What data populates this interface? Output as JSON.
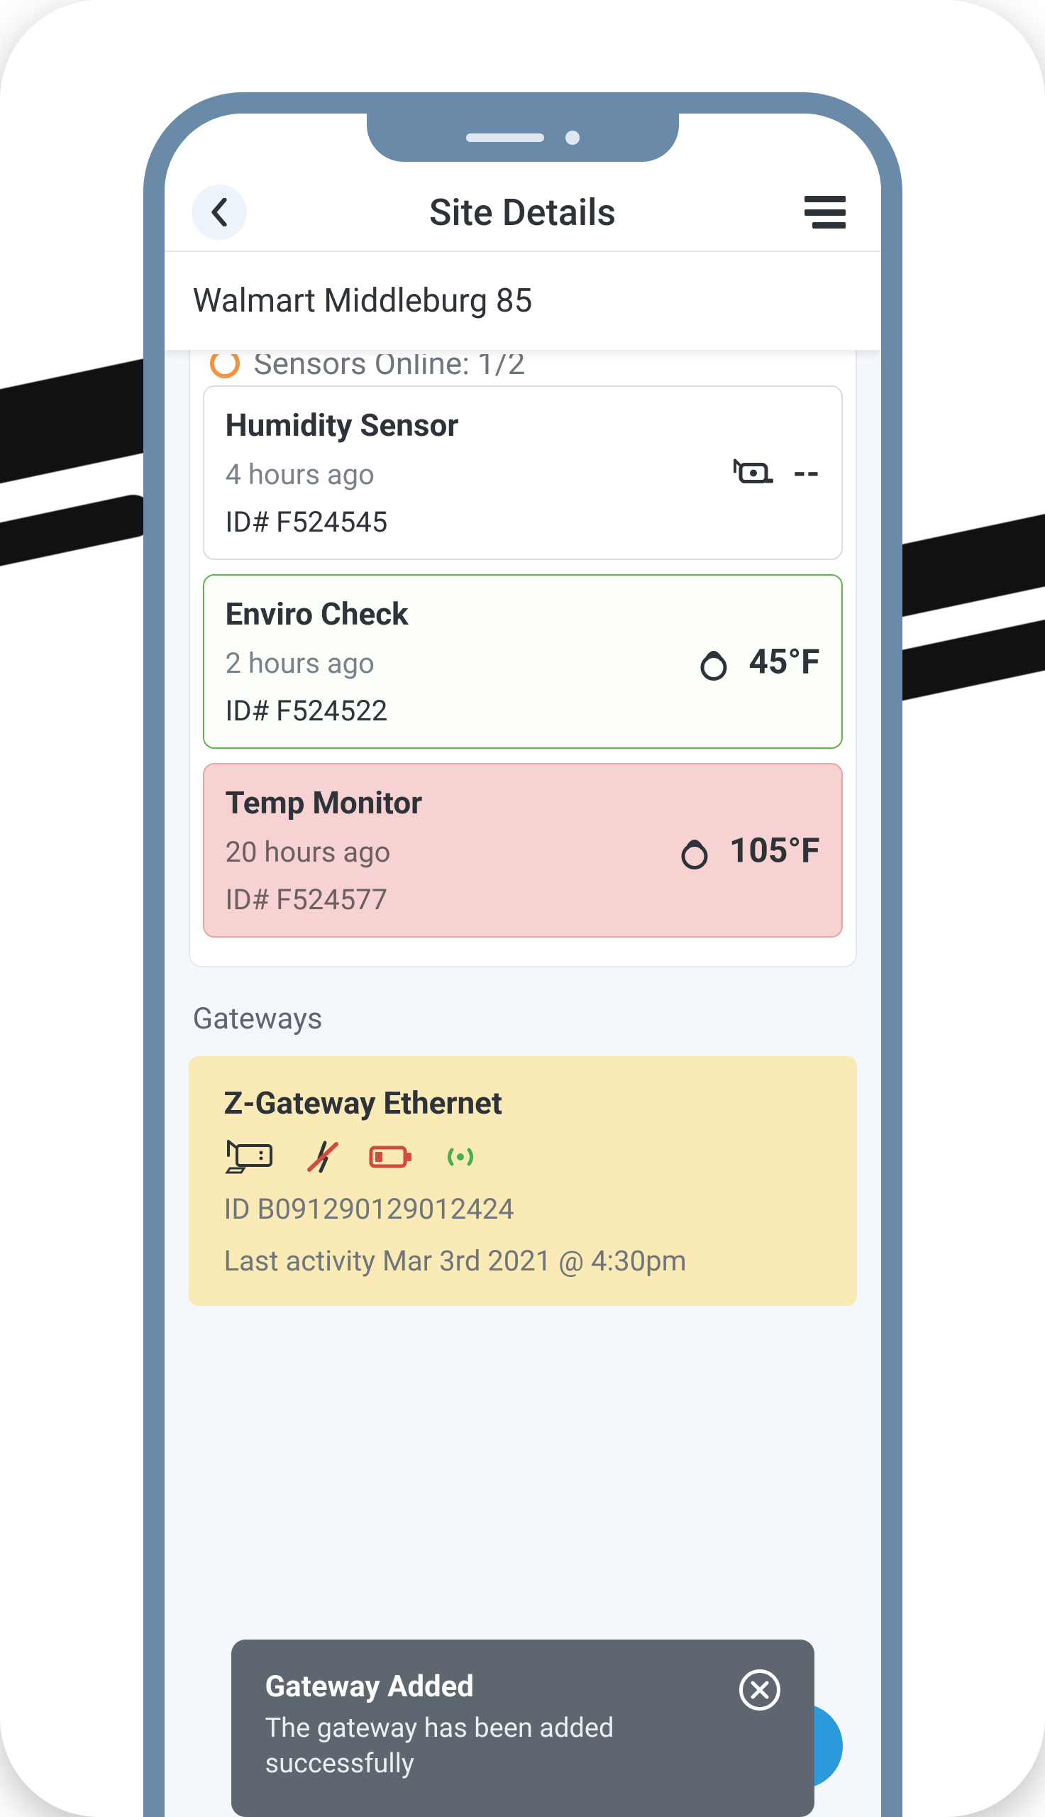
{
  "nav": {
    "title": "Site Details"
  },
  "site": {
    "name": "Walmart Middleburg 85"
  },
  "sensors": {
    "statusLine": "Sensors Online: 1/2",
    "items": [
      {
        "name": "Humidity Sensor",
        "ago": "4 hours ago",
        "id": "ID# F524545",
        "value": "--",
        "tone": "plain"
      },
      {
        "name": "Enviro Check",
        "ago": "2 hours ago",
        "id": "ID# F524522",
        "value": "45°F",
        "tone": "green"
      },
      {
        "name": "Temp Monitor",
        "ago": "20 hours ago",
        "id": "ID# F524577",
        "value": "105°F",
        "tone": "red"
      }
    ]
  },
  "gateways": {
    "label": "Gateways",
    "card": {
      "name": "Z-Gateway Ethernet",
      "id": "ID B091290129012424",
      "lastActivity": "Last activity Mar 3rd 2021 @ 4:30pm"
    }
  },
  "toast": {
    "title": "Gateway Added",
    "message": "The gateway has been added successfully"
  }
}
